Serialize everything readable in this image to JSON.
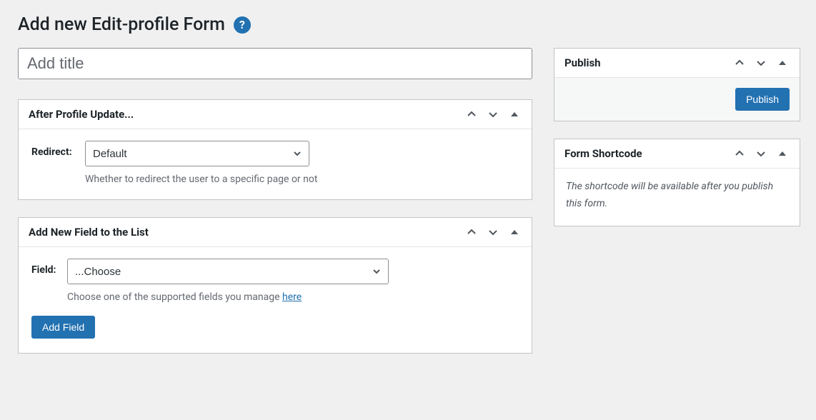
{
  "header": {
    "title": "Add new Edit-profile Form"
  },
  "title_input": {
    "placeholder": "Add title",
    "value": ""
  },
  "after_profile_update": {
    "panel_title": "After Profile Update...",
    "redirect_label": "Redirect:",
    "redirect_value": "Default",
    "help_text": "Whether to redirect the user to a specific page or not"
  },
  "add_field": {
    "panel_title": "Add New Field to the List",
    "field_label": "Field:",
    "field_value": "...Choose",
    "help_text_prefix": "Choose one of the supported fields you manage ",
    "help_link_text": "here",
    "button_label": "Add Field"
  },
  "publish": {
    "panel_title": "Publish",
    "button_label": "Publish"
  },
  "shortcode": {
    "panel_title": "Form Shortcode",
    "message": "The shortcode will be available after you publish this form."
  }
}
